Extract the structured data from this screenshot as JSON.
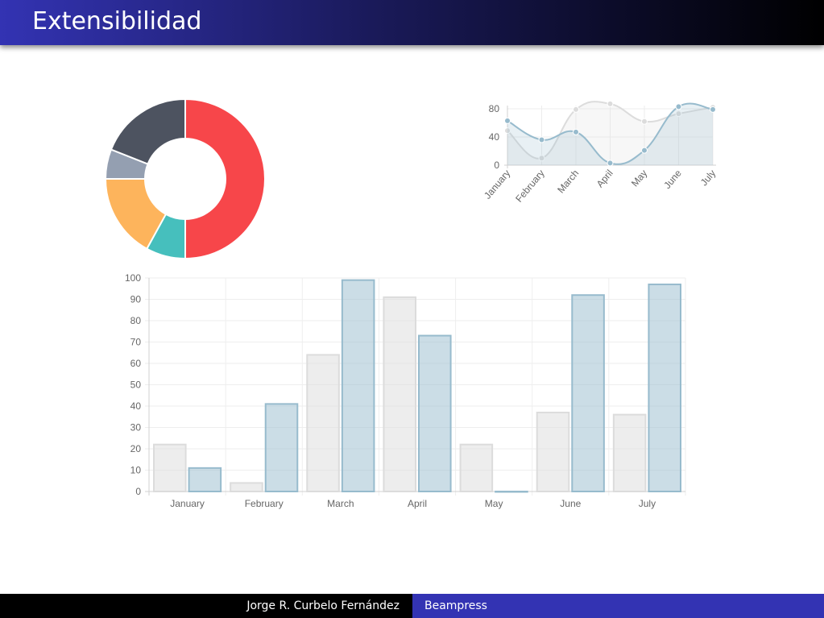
{
  "slide": {
    "title": "Extensibilidad"
  },
  "footer": {
    "author": "Jorge R. Curbelo Fernández",
    "presentation": "Beampress"
  },
  "colors": {
    "title_gradient_start": "#3333b3",
    "footer_right_bg": "#3333b3",
    "series_gray": "#dcdcdc",
    "series_blue": "#97bbcd"
  },
  "chart_data": [
    {
      "type": "pie",
      "variant": "doughnut",
      "values": [
        50,
        8,
        17,
        6,
        19
      ],
      "colors": [
        "#f7464a",
        "#46bfbd",
        "#fdb45c",
        "#949fb1",
        "#4d5360"
      ]
    },
    {
      "type": "line",
      "categories": [
        "January",
        "February",
        "March",
        "April",
        "May",
        "June",
        "July"
      ],
      "series": [
        {
          "values": [
            49,
            10,
            79,
            87,
            62,
            73,
            82
          ],
          "color": "#dcdcdc"
        },
        {
          "values": [
            63,
            36,
            47,
            3,
            21,
            83,
            79
          ],
          "color": "#97bbcd"
        }
      ],
      "yticks": [
        0,
        40,
        80
      ],
      "ylim": [
        0,
        80
      ],
      "smooth": true,
      "area_fill": true
    },
    {
      "type": "bar",
      "categories": [
        "January",
        "February",
        "March",
        "April",
        "May",
        "June",
        "July"
      ],
      "series": [
        {
          "values": [
            22,
            4,
            64,
            91,
            22,
            37,
            36
          ],
          "color": "#dcdcdc"
        },
        {
          "values": [
            11,
            41,
            99,
            73,
            0,
            92,
            97
          ],
          "color": "#97bbcd"
        }
      ],
      "yticks": [
        0,
        10,
        20,
        30,
        40,
        50,
        60,
        70,
        80,
        90,
        100
      ],
      "ylim": [
        0,
        100
      ],
      "grid": true
    }
  ]
}
